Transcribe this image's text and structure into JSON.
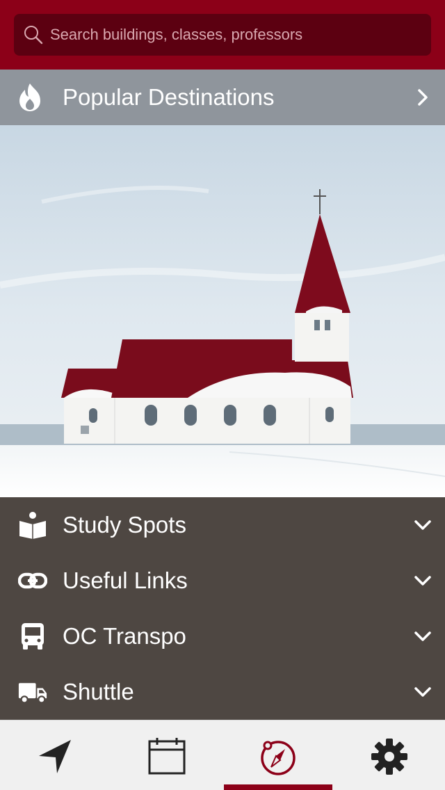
{
  "search": {
    "placeholder": "Search buildings, classes, professors",
    "icon": "search-icon"
  },
  "popular": {
    "label": "Popular Destinations",
    "icon": "flame-icon"
  },
  "hero": {
    "description_icon": "church-photo"
  },
  "menu": {
    "items": [
      {
        "label": "Study Spots",
        "icon": "study-reader-icon"
      },
      {
        "label": "Useful Links",
        "icon": "link-icon"
      },
      {
        "label": "OC Transpo",
        "icon": "bus-icon"
      },
      {
        "label": "Shuttle",
        "icon": "truck-icon"
      }
    ]
  },
  "tabbar": {
    "tabs": [
      {
        "icon": "navigation-arrow-icon",
        "active": false
      },
      {
        "icon": "calendar-icon",
        "active": false
      },
      {
        "icon": "compass-icon",
        "active": true
      },
      {
        "icon": "gear-icon",
        "active": false
      }
    ]
  },
  "colors": {
    "brand": "#8c0018",
    "search_bg": "#5c0011",
    "popular_bar": "#8f959c",
    "menu_bg": "#4e4742",
    "tabbar_bg": "#f0f0f0"
  }
}
